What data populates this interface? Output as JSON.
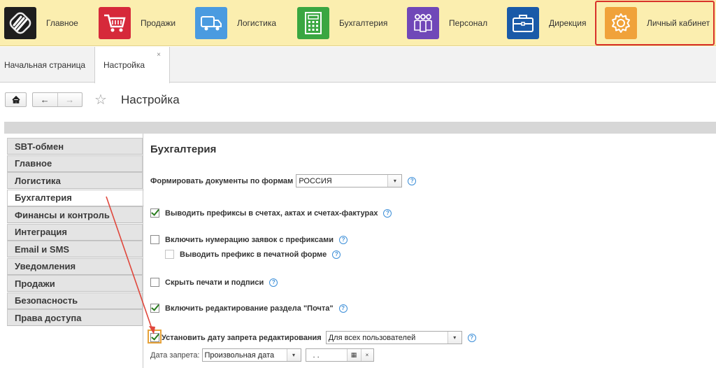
{
  "sections": [
    {
      "label": "Главное",
      "icon": "logo-icon",
      "color": "#1e1e1e"
    },
    {
      "label": "Продажи",
      "icon": "shopping-cart-icon",
      "color": "#d6293a"
    },
    {
      "label": "Логистика",
      "icon": "truck-icon",
      "color": "#4a9be0"
    },
    {
      "label": "Бухгалтерия",
      "icon": "calculator-icon",
      "color": "#3aa641"
    },
    {
      "label": "Персонал",
      "icon": "people-icon",
      "color": "#7048b8"
    },
    {
      "label": "Дирекция",
      "icon": "briefcase-icon",
      "color": "#1a5aa8"
    },
    {
      "label": "Личный кабинет",
      "icon": "gear-icon",
      "color": "#f0a23a"
    }
  ],
  "tabs": {
    "home": "Начальная страница",
    "current": "Настройка",
    "close": "×"
  },
  "nav": {
    "home_icon": "⌂",
    "back": "←",
    "forward": "→",
    "star": "☆",
    "title": "Настройка"
  },
  "menu": {
    "items": [
      "SBT-обмен",
      "Главное",
      "Логистика",
      "Бухгалтерия",
      "Финансы и контроль",
      "Интеграция",
      "Email и SMS",
      "Уведомления",
      "Продажи",
      "Безопасность",
      "Права доступа"
    ],
    "selected": "Бухгалтерия"
  },
  "content": {
    "heading": "Бухгалтерия",
    "form_docs_label": "Формировать документы по формам",
    "form_docs_value": "РОССИЯ",
    "prefixes_label": "Выводить префиксы в счетах, актах и счетах-фактурах",
    "prefixes_checked": true,
    "numbering_label": "Включить нумерацию заявок с префиксами",
    "numbering_checked": false,
    "print_prefix_label": "Выводить префикс в печатной форме",
    "print_prefix_checked": false,
    "hide_stamps_label": "Скрыть печати и подписи",
    "hide_stamps_checked": false,
    "mail_edit_label": "Включить редактирование раздела \"Почта\"",
    "mail_edit_checked": true,
    "lock_date_label": "Установить дату запрета редактирования",
    "lock_date_checked": true,
    "lock_date_scope": "Для всех пользователей",
    "ban_date_label": "Дата запрета:",
    "ban_date_type": "Произвольная дата",
    "ban_date_value": ". .",
    "help": "?",
    "dropdown": "▾",
    "clear": "×"
  },
  "colors": {
    "topbar": "#fbeeaf",
    "active_border": "#d9322a",
    "arrow": "#e0473c",
    "highlight": "#e6a23a",
    "check": "#2a7d1f"
  }
}
